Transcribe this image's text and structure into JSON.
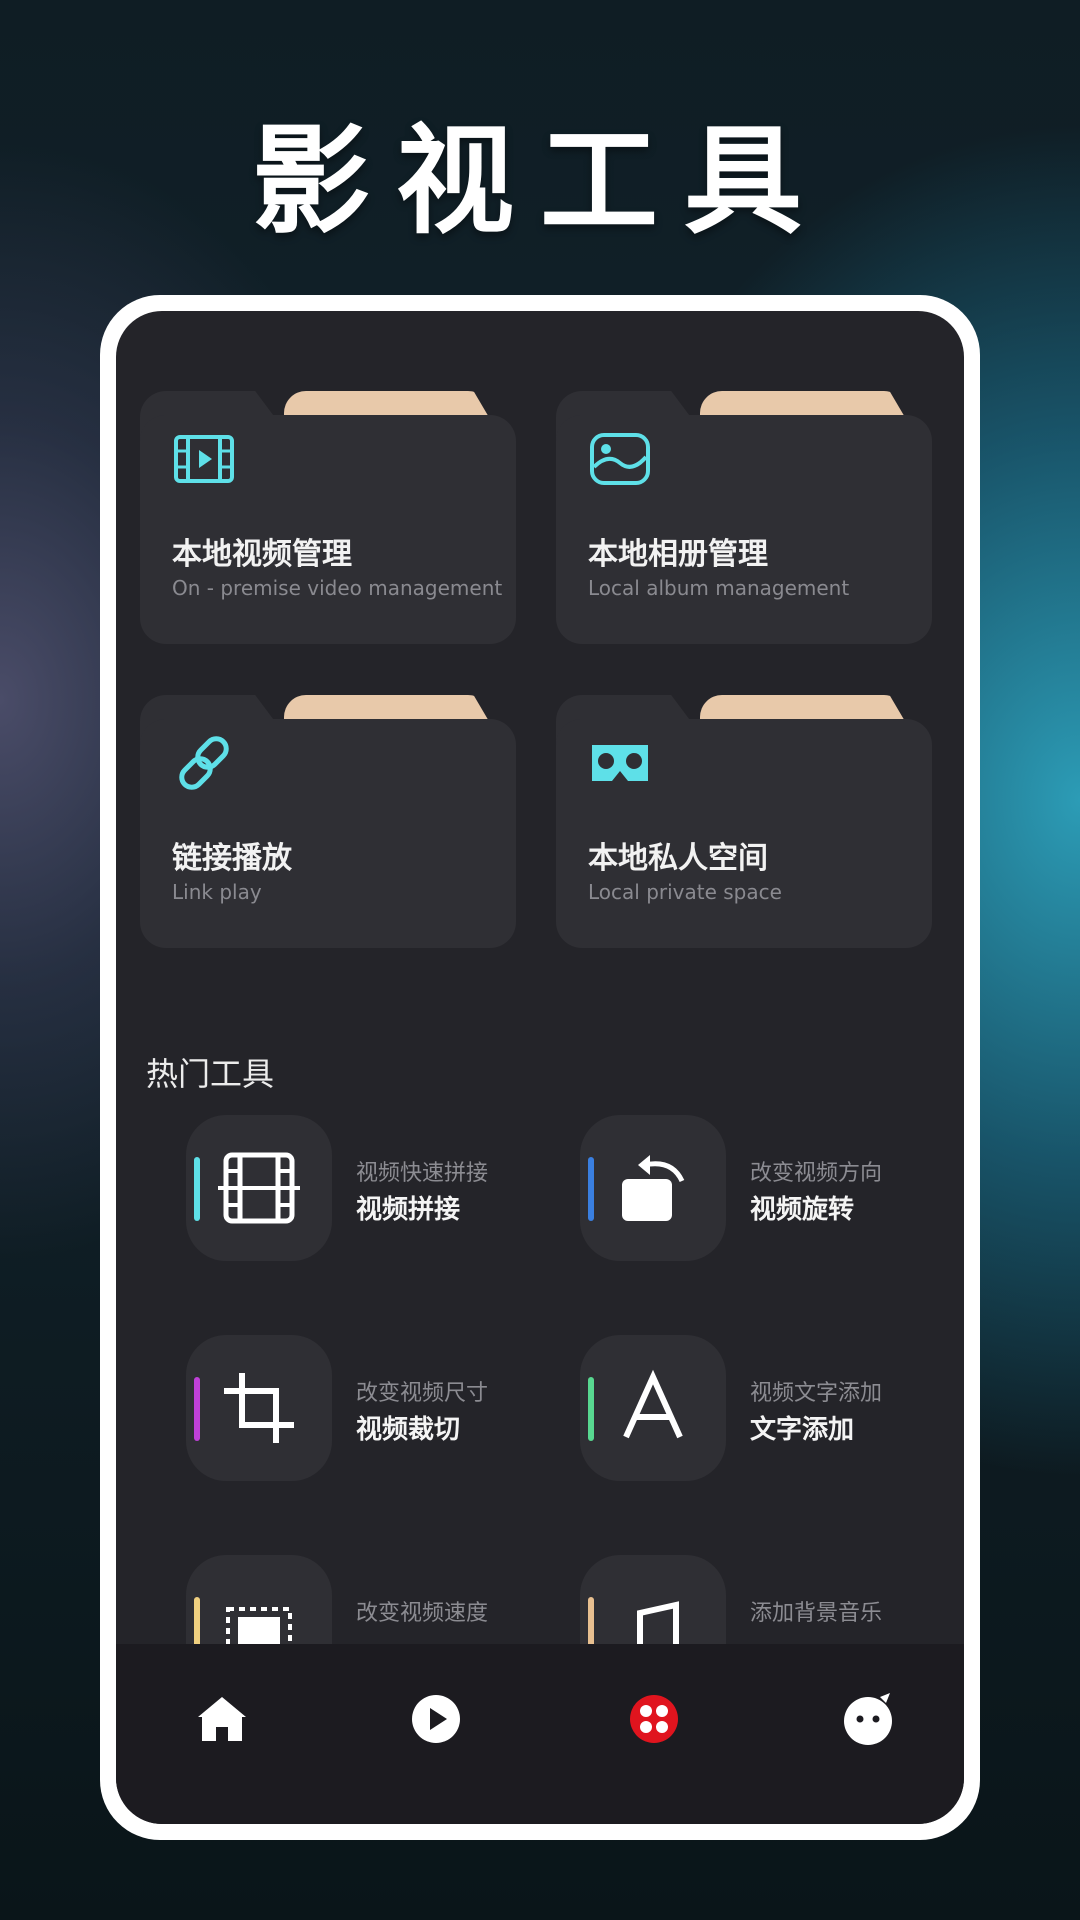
{
  "promo": {
    "title": "影视工具"
  },
  "cards": [
    {
      "title": "本地视频管理",
      "subtitle": "On - premise video management",
      "icon": "film-icon"
    },
    {
      "title": "本地相册管理",
      "subtitle": "Local album management",
      "icon": "image-icon"
    },
    {
      "title": "链接播放",
      "subtitle": "Link play",
      "icon": "link-icon"
    },
    {
      "title": "本地私人空间",
      "subtitle": "Local private space",
      "icon": "vr-goggles-icon"
    }
  ],
  "section": {
    "title": "热门工具"
  },
  "tools": [
    {
      "subtitle": "视频快速拼接",
      "name": "视频拼接",
      "accent": "#5ee0e8",
      "icon": "filmstrip-icon"
    },
    {
      "subtitle": "改变视频方向",
      "name": "视频旋转",
      "accent": "#3a7fe0",
      "icon": "rotate-icon"
    },
    {
      "subtitle": "改变视频尺寸",
      "name": "视频裁切",
      "accent": "#c040d8",
      "icon": "crop-icon"
    },
    {
      "subtitle": "视频文字添加",
      "name": "文字添加",
      "accent": "#58d890",
      "icon": "text-icon"
    },
    {
      "subtitle": "改变视频速度",
      "name": "",
      "accent": "#f0d080",
      "icon": "speed-icon"
    },
    {
      "subtitle": "添加背景音乐",
      "name": "",
      "accent": "#e8c090",
      "icon": "music-note-icon"
    }
  ],
  "tabbar": {
    "items": [
      {
        "name": "home",
        "icon": "home-icon"
      },
      {
        "name": "play",
        "icon": "play-icon"
      },
      {
        "name": "tools",
        "icon": "tools-icon",
        "active_color": "#e0141e"
      },
      {
        "name": "profile",
        "icon": "profile-icon"
      }
    ]
  },
  "colors": {
    "card_tab": "#e8c9aa",
    "icon_cyan": "#5ee0e8",
    "screen_bg": "#242429"
  }
}
